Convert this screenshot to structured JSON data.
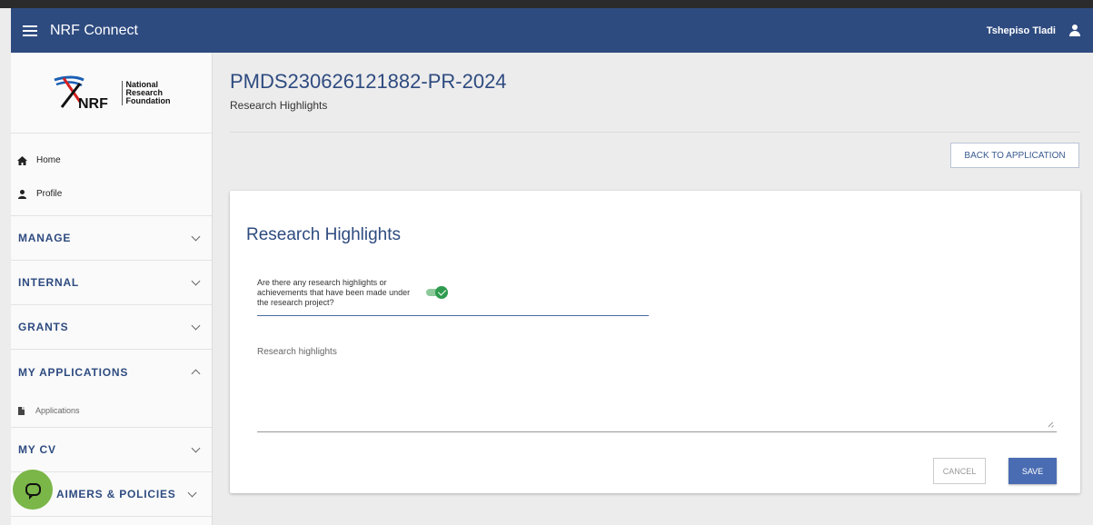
{
  "app": {
    "title": "NRF Connect",
    "user_name": "Tshepiso Tladi",
    "brand_color": "#2e4b80"
  },
  "logo": {
    "mark": "NRF",
    "text_lines": [
      "National",
      "Research",
      "Foundation"
    ]
  },
  "sidebar": {
    "links": [
      {
        "label": "Home",
        "icon": "home-icon"
      },
      {
        "label": "Profile",
        "icon": "person-icon"
      }
    ],
    "sections": [
      {
        "label": "MANAGE",
        "expanded": false
      },
      {
        "label": "INTERNAL",
        "expanded": false
      },
      {
        "label": "GRANTS",
        "expanded": false
      },
      {
        "label": "MY APPLICATIONS",
        "expanded": true,
        "items": [
          {
            "label": "Applications",
            "icon": "document-icon"
          }
        ]
      },
      {
        "label": "MY CV",
        "expanded": false
      },
      {
        "label": "AIMERS & POLICIES",
        "expanded": false
      }
    ]
  },
  "page": {
    "title": "PMDS230626121882-PR-2024",
    "subtitle": "Research Highlights",
    "back_button": "BACK TO APPLICATION"
  },
  "form": {
    "title": "Research Highlights",
    "question": "Are there any research highlights or achievements that have been made under the research project?",
    "toggle_on": true,
    "textarea_placeholder": "Research highlights",
    "textarea_value": "",
    "cancel_label": "CANCEL",
    "save_label": "SAVE"
  }
}
